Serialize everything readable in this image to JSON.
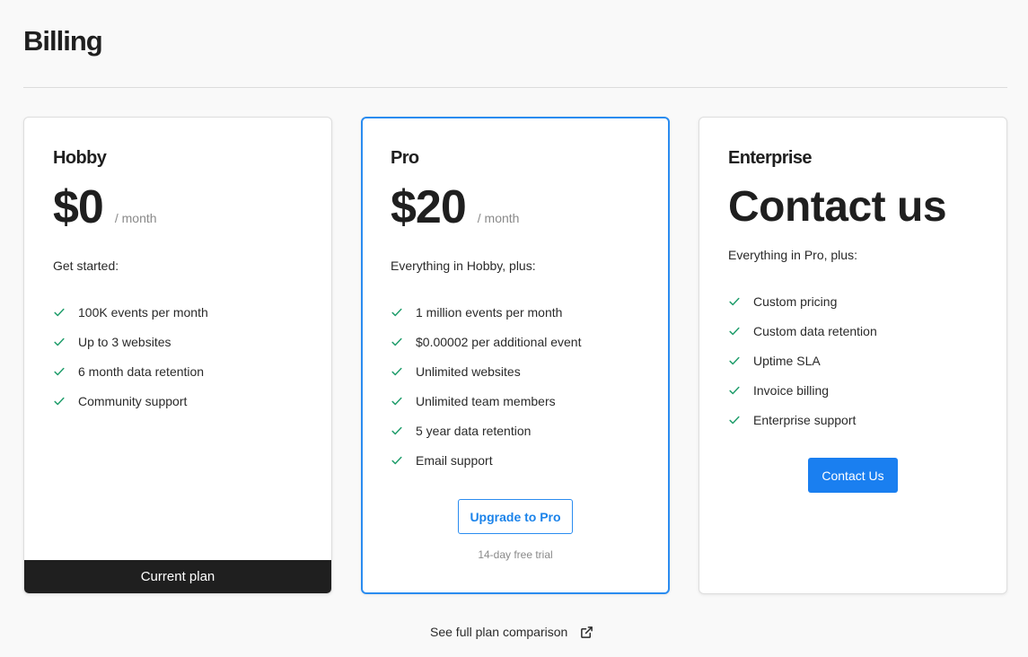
{
  "page": {
    "title": "Billing"
  },
  "icons": {
    "check": "check-icon",
    "external": "external-link-icon"
  },
  "colors": {
    "accent": "#1a7ff0",
    "check": "#1f9d6b",
    "dark": "#1f1f1f"
  },
  "plans": {
    "hobby": {
      "name": "Hobby",
      "price": "$0",
      "period": "/ month",
      "intro": "Get started:",
      "features": [
        "100K events per month",
        "Up to 3 websites",
        "6 month data retention",
        "Community support"
      ],
      "footer_label": "Current plan"
    },
    "pro": {
      "name": "Pro",
      "price": "$20",
      "period": "/ month",
      "intro": "Everything in Hobby, plus:",
      "features": [
        "1 million events per month",
        "$0.00002 per additional event",
        "Unlimited websites",
        "Unlimited team members",
        "5 year data retention",
        "Email support"
      ],
      "button_label": "Upgrade to Pro",
      "trial_note": "14-day free trial"
    },
    "enterprise": {
      "name": "Enterprise",
      "price": "Contact us",
      "intro": "Everything in Pro, plus:",
      "features": [
        "Custom pricing",
        "Custom data retention",
        "Uptime SLA",
        "Invoice billing",
        "Enterprise support"
      ],
      "button_label": "Contact Us"
    }
  },
  "footer": {
    "compare_link": "See full plan comparison"
  }
}
